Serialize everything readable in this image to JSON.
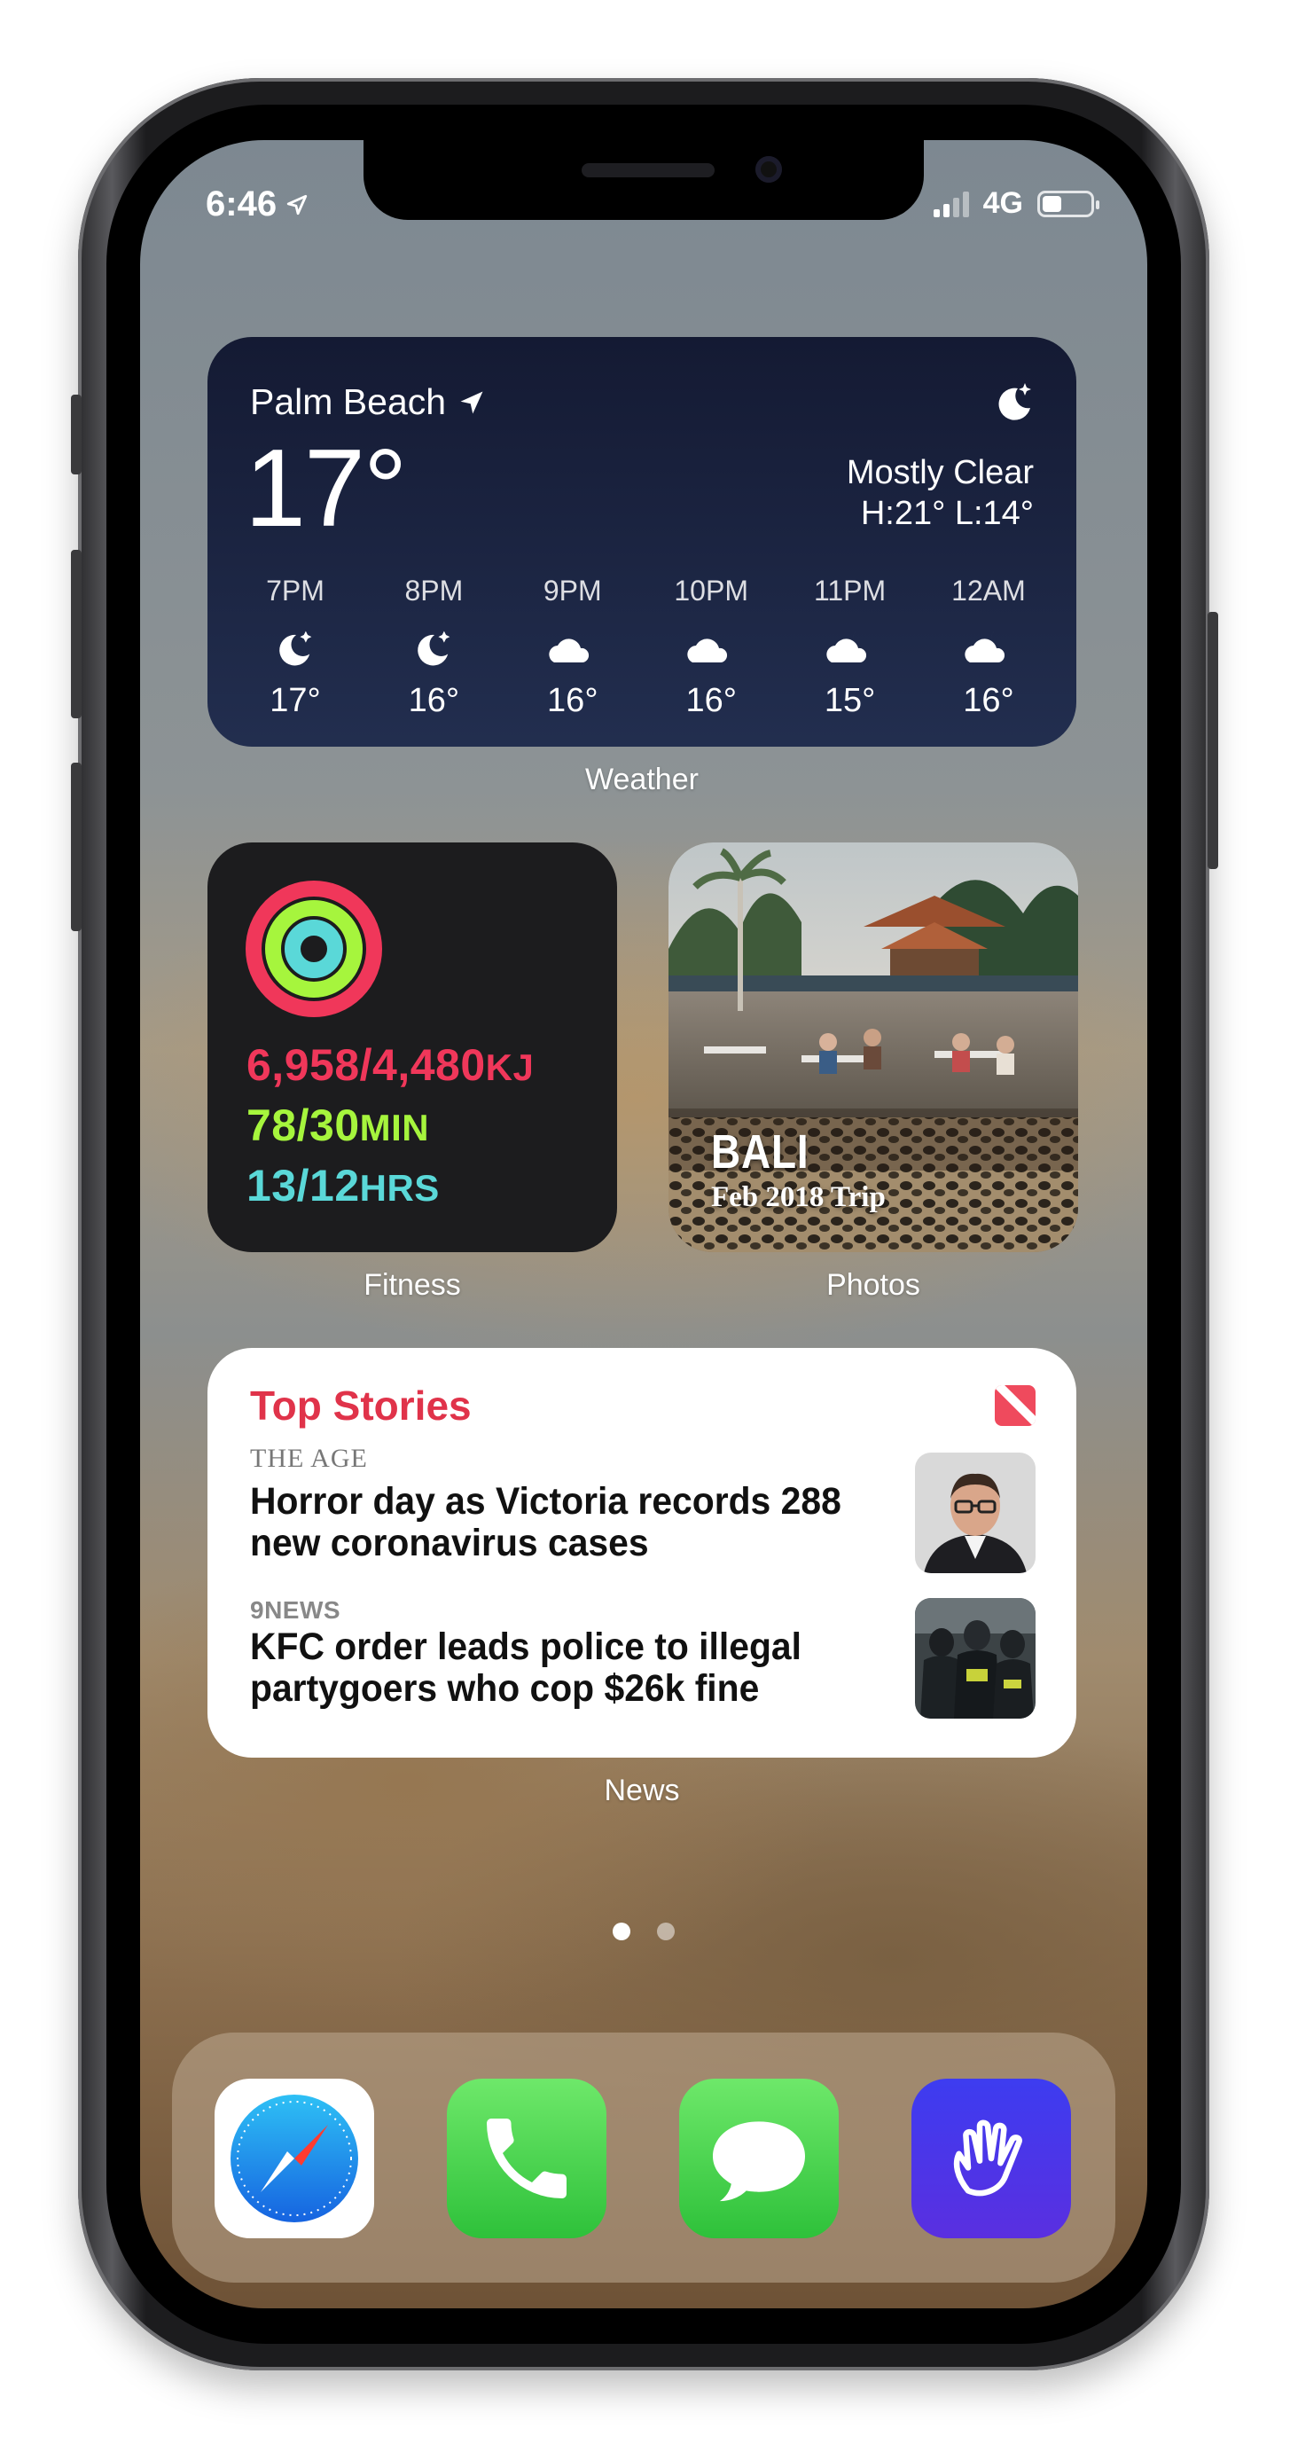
{
  "status_bar": {
    "time": "6:46",
    "network": "4G",
    "battery_level": 0.4,
    "icons": [
      "location-arrow-icon",
      "signal-bars-icon",
      "battery-icon"
    ]
  },
  "weather_widget": {
    "location": "Palm Beach",
    "temperature": "17°",
    "condition": "Mostly Clear",
    "high_low": "H:21° L:14°",
    "caption": "Weather",
    "current_icon": "moon-stars-icon",
    "hourly": [
      {
        "time": "7PM",
        "temp": "17°",
        "icon": "moon-stars-icon"
      },
      {
        "time": "8PM",
        "temp": "16°",
        "icon": "moon-stars-icon"
      },
      {
        "time": "9PM",
        "temp": "16°",
        "icon": "cloud-moon-icon"
      },
      {
        "time": "10PM",
        "temp": "16°",
        "icon": "cloud-moon-icon"
      },
      {
        "time": "11PM",
        "temp": "15°",
        "icon": "cloud-moon-icon"
      },
      {
        "time": "12AM",
        "temp": "16°",
        "icon": "cloud-moon-icon"
      }
    ]
  },
  "fitness_widget": {
    "caption": "Fitness",
    "move": {
      "value": "6,958/4,480",
      "unit": "KJ",
      "color": "#f0375a",
      "progress": 1.0
    },
    "exercise": {
      "value": "78/30",
      "unit": "MIN",
      "color": "#a6f53d",
      "progress": 1.0
    },
    "stand": {
      "value": "13/12",
      "unit": "HRS",
      "color": "#5ad8d8",
      "progress": 1.0
    }
  },
  "photos_widget": {
    "caption": "Photos",
    "title": "BALI",
    "subtitle": "Feb 2018 Trip"
  },
  "news_widget": {
    "caption": "News",
    "header": "Top Stories",
    "accent_color": "#e0334a",
    "stories": [
      {
        "source": "THE AGE",
        "headline": "Horror day as Victoria records 288 new coronavirus cases"
      },
      {
        "source": "9NEWS",
        "headline": "KFC order leads police to illegal partygoers who cop $26k fine"
      }
    ]
  },
  "page_indicator": {
    "count": 2,
    "current": 1
  },
  "dock": {
    "apps": [
      {
        "name": "Safari",
        "icon": "safari-compass-icon"
      },
      {
        "name": "Phone",
        "icon": "phone-handset-icon"
      },
      {
        "name": "Messages",
        "icon": "speech-bubble-icon"
      },
      {
        "name": "Hand app",
        "icon": "hand-wave-icon"
      }
    ]
  }
}
